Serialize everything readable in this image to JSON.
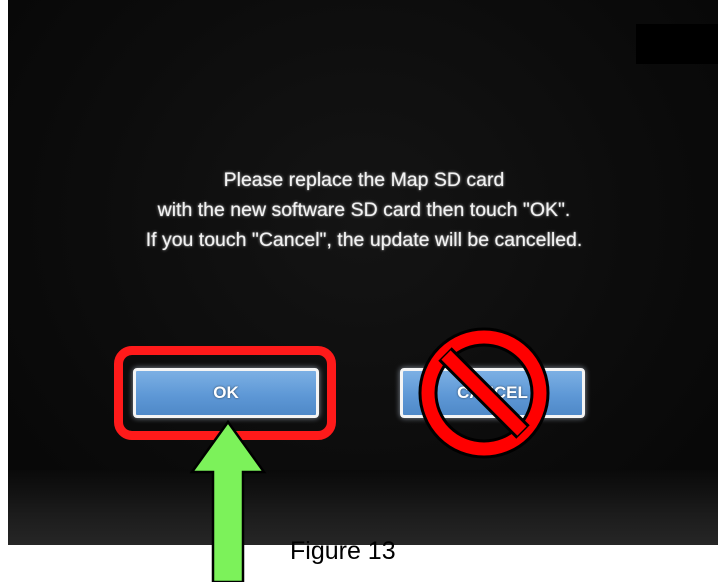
{
  "dialog": {
    "message_lines": [
      "Please replace the Map SD card",
      "with the new software SD card then touch \"OK\".",
      "If you touch \"Cancel\", the update will be cancelled."
    ],
    "ok_label": "OK",
    "cancel_label": "CANCEL"
  },
  "figure": {
    "caption": "Figure 13"
  },
  "annotations": {
    "ok_highlight_color": "#ff1a1a",
    "arrow_color": "#7cf25a",
    "no_symbol": "prohibited-icon"
  },
  "colors": {
    "button_fill": "#5e98d6",
    "screen_background": "#0c0c0c",
    "text": "#f2f2f2"
  }
}
